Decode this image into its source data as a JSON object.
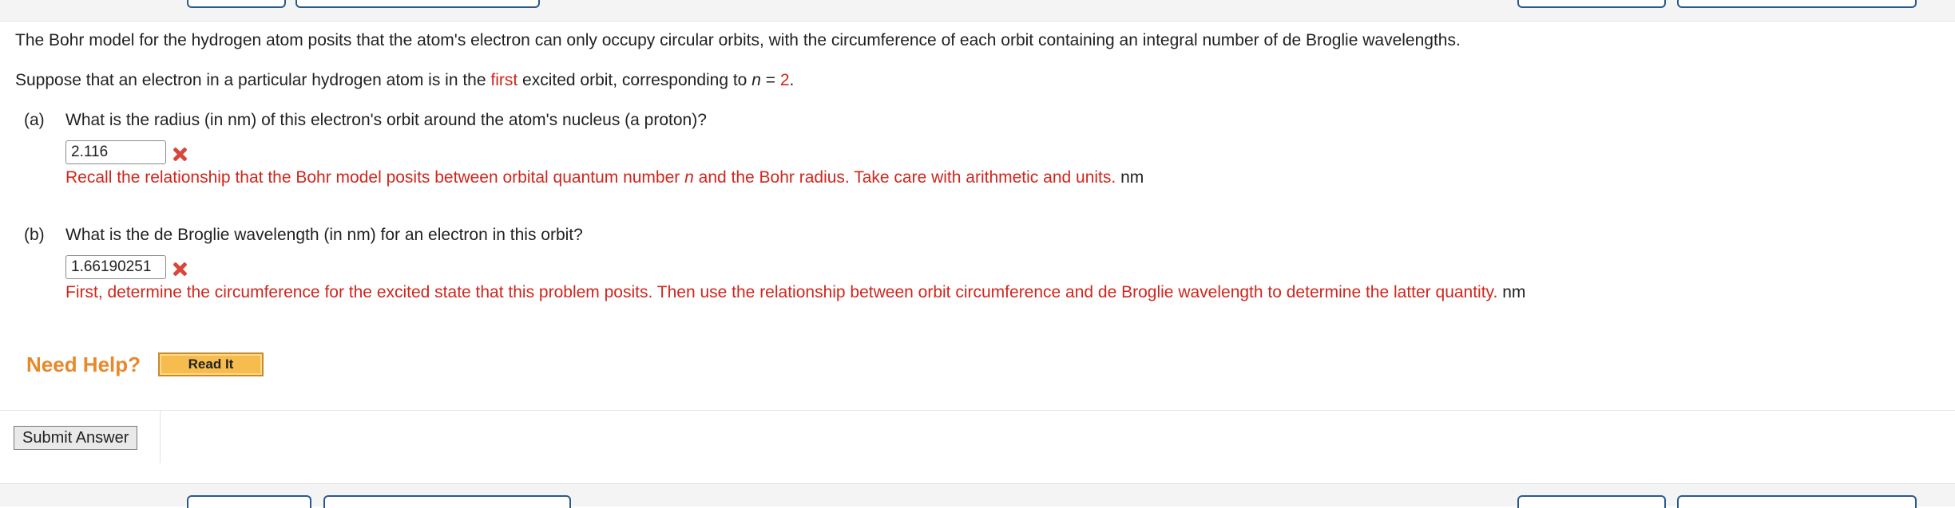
{
  "intro": "The Bohr model for the hydrogen atom posits that the atom's electron can only occupy circular orbits, with the circumference of each orbit containing an integral number of de Broglie wavelengths.",
  "suppose": {
    "before": "Suppose that an electron in a particular hydrogen atom is in the ",
    "highlight": "first",
    "middle": " excited orbit, corresponding to ",
    "var": "n",
    "equals": " = ",
    "value": "2",
    "end": "."
  },
  "part_a": {
    "label": "(a)",
    "question": "What is the radius (in nm) of this electron's orbit around the atom's nucleus (a proton)?",
    "answer": "2.116",
    "feedback_before": "Recall the relationship that the Bohr model posits between orbital quantum number ",
    "feedback_var": "n",
    "feedback_after": " and the Bohr radius. Take care with arithmetic and units.",
    "unit": "nm"
  },
  "part_b": {
    "label": "(b)",
    "question": "What is the de Broglie wavelength (in nm) for an electron in this orbit?",
    "answer": "1.66190251",
    "feedback": "First, determine the circumference for the excited state that this problem posits. Then use the relationship between orbit circumference and de Broglie wavelength to determine the latter quantity.",
    "unit": "nm"
  },
  "help": {
    "label": "Need Help?",
    "read_it": "Read It"
  },
  "submit_label": "Submit Answer",
  "colors": {
    "feedback_red": "#d0261d",
    "help_orange": "#e8882c",
    "nav_border": "#2b5a8a"
  }
}
